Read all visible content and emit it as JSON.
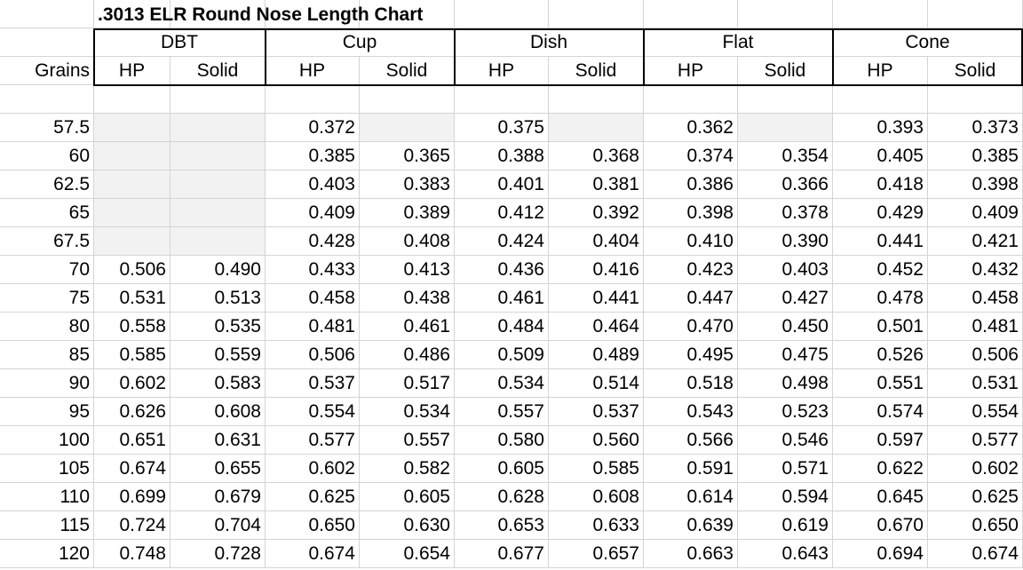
{
  "title": ".3013 ELR Round Nose Length Chart",
  "row_header": "Grains",
  "groups": [
    {
      "name": "DBT",
      "cols": [
        "HP",
        "Solid"
      ]
    },
    {
      "name": "Cup",
      "cols": [
        "HP",
        "Solid"
      ]
    },
    {
      "name": "Dish",
      "cols": [
        "HP",
        "Solid"
      ]
    },
    {
      "name": "Flat",
      "cols": [
        "HP",
        "Solid"
      ]
    },
    {
      "name": "Cone",
      "cols": [
        "HP",
        "Solid"
      ]
    }
  ],
  "rows": [
    {
      "grains": "57.5",
      "values": [
        "",
        "",
        "0.372",
        "",
        "0.375",
        "",
        "0.362",
        "",
        "0.393",
        "0.373"
      ]
    },
    {
      "grains": "60",
      "values": [
        "",
        "",
        "0.385",
        "0.365",
        "0.388",
        "0.368",
        "0.374",
        "0.354",
        "0.405",
        "0.385"
      ]
    },
    {
      "grains": "62.5",
      "values": [
        "",
        "",
        "0.403",
        "0.383",
        "0.401",
        "0.381",
        "0.386",
        "0.366",
        "0.418",
        "0.398"
      ]
    },
    {
      "grains": "65",
      "values": [
        "",
        "",
        "0.409",
        "0.389",
        "0.412",
        "0.392",
        "0.398",
        "0.378",
        "0.429",
        "0.409"
      ]
    },
    {
      "grains": "67.5",
      "values": [
        "",
        "",
        "0.428",
        "0.408",
        "0.424",
        "0.404",
        "0.410",
        "0.390",
        "0.441",
        "0.421"
      ]
    },
    {
      "grains": "70",
      "values": [
        "0.506",
        "0.490",
        "0.433",
        "0.413",
        "0.436",
        "0.416",
        "0.423",
        "0.403",
        "0.452",
        "0.432"
      ]
    },
    {
      "grains": "75",
      "values": [
        "0.531",
        "0.513",
        "0.458",
        "0.438",
        "0.461",
        "0.441",
        "0.447",
        "0.427",
        "0.478",
        "0.458"
      ]
    },
    {
      "grains": "80",
      "values": [
        "0.558",
        "0.535",
        "0.481",
        "0.461",
        "0.484",
        "0.464",
        "0.470",
        "0.450",
        "0.501",
        "0.481"
      ]
    },
    {
      "grains": "85",
      "values": [
        "0.585",
        "0.559",
        "0.506",
        "0.486",
        "0.509",
        "0.489",
        "0.495",
        "0.475",
        "0.526",
        "0.506"
      ]
    },
    {
      "grains": "90",
      "values": [
        "0.602",
        "0.583",
        "0.537",
        "0.517",
        "0.534",
        "0.514",
        "0.518",
        "0.498",
        "0.551",
        "0.531"
      ]
    },
    {
      "grains": "95",
      "values": [
        "0.626",
        "0.608",
        "0.554",
        "0.534",
        "0.557",
        "0.537",
        "0.543",
        "0.523",
        "0.574",
        "0.554"
      ]
    },
    {
      "grains": "100",
      "values": [
        "0.651",
        "0.631",
        "0.577",
        "0.557",
        "0.580",
        "0.560",
        "0.566",
        "0.546",
        "0.597",
        "0.577"
      ]
    },
    {
      "grains": "105",
      "values": [
        "0.674",
        "0.655",
        "0.602",
        "0.582",
        "0.605",
        "0.585",
        "0.591",
        "0.571",
        "0.622",
        "0.602"
      ]
    },
    {
      "grains": "110",
      "values": [
        "0.699",
        "0.679",
        "0.625",
        "0.605",
        "0.628",
        "0.608",
        "0.614",
        "0.594",
        "0.645",
        "0.625"
      ]
    },
    {
      "grains": "115",
      "values": [
        "0.724",
        "0.704",
        "0.650",
        "0.630",
        "0.653",
        "0.633",
        "0.639",
        "0.619",
        "0.670",
        "0.650"
      ]
    },
    {
      "grains": "120",
      "values": [
        "0.748",
        "0.728",
        "0.674",
        "0.654",
        "0.677",
        "0.657",
        "0.663",
        "0.643",
        "0.694",
        "0.674"
      ]
    }
  ],
  "shaded_cells": [
    {
      "row": 0,
      "col": 0
    },
    {
      "row": 0,
      "col": 1
    },
    {
      "row": 0,
      "col": 3
    },
    {
      "row": 0,
      "col": 5
    },
    {
      "row": 0,
      "col": 7
    },
    {
      "row": 1,
      "col": 0
    },
    {
      "row": 1,
      "col": 1
    },
    {
      "row": 2,
      "col": 0
    },
    {
      "row": 2,
      "col": 1
    },
    {
      "row": 3,
      "col": 0
    },
    {
      "row": 3,
      "col": 1
    },
    {
      "row": 4,
      "col": 0
    },
    {
      "row": 4,
      "col": 1
    }
  ],
  "colors": {
    "shade": "#f2f2f2",
    "gridline": "#d4d4d4",
    "border": "#000000"
  }
}
